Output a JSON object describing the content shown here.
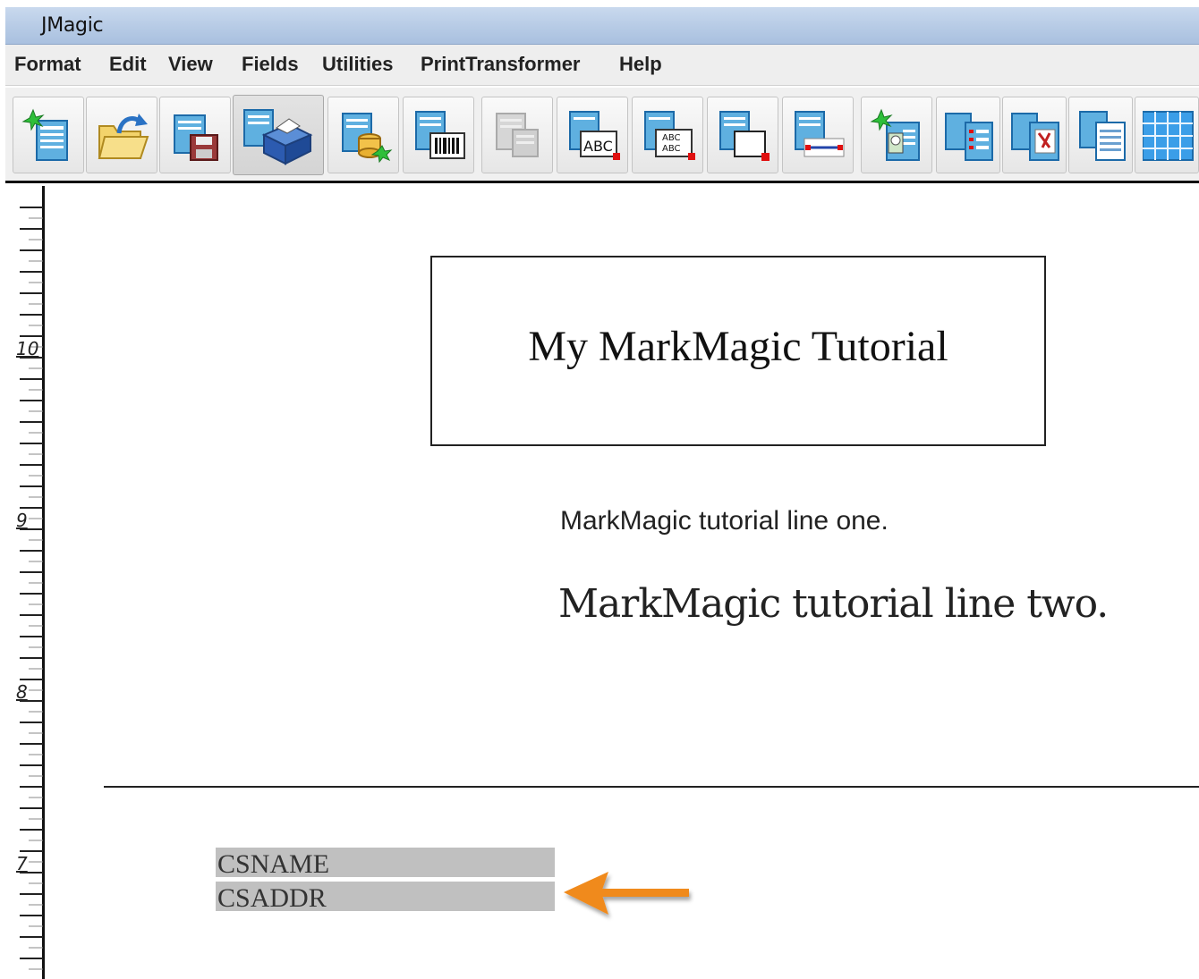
{
  "window": {
    "title": "JMagic"
  },
  "menubar": {
    "items": [
      "Format",
      "Edit",
      "View",
      "Fields",
      "Utilities",
      "PrintTransformer",
      "Help"
    ]
  },
  "toolbar": {
    "buttons": [
      {
        "name": "new-format-icon"
      },
      {
        "name": "open-folder-icon"
      },
      {
        "name": "save-icon"
      },
      {
        "name": "print-icon",
        "pressed": true
      },
      {
        "name": "database-icon"
      },
      {
        "name": "barcode-icon"
      },
      {
        "name": "disabled-copy-icon",
        "disabled": true
      },
      {
        "name": "text-field-icon"
      },
      {
        "name": "multi-text-icon"
      },
      {
        "name": "box-icon"
      },
      {
        "name": "line-icon"
      },
      {
        "name": "image-icon"
      },
      {
        "name": "list-icon"
      },
      {
        "name": "graphic-icon"
      },
      {
        "name": "copy-icon"
      },
      {
        "name": "grid-icon"
      }
    ]
  },
  "ruler": {
    "labels": [
      "10",
      "9",
      "8",
      "7"
    ]
  },
  "document": {
    "title": "My MarkMagic Tutorial",
    "line_one": "MarkMagic tutorial line one.",
    "line_two": "MarkMagic tutorial line two.",
    "fields": [
      "CSNAME",
      "CSADDR"
    ]
  },
  "colors": {
    "arrow": "#f08a1c",
    "field_bg": "#c0c0c0",
    "titlebar": "#b8cce6"
  }
}
